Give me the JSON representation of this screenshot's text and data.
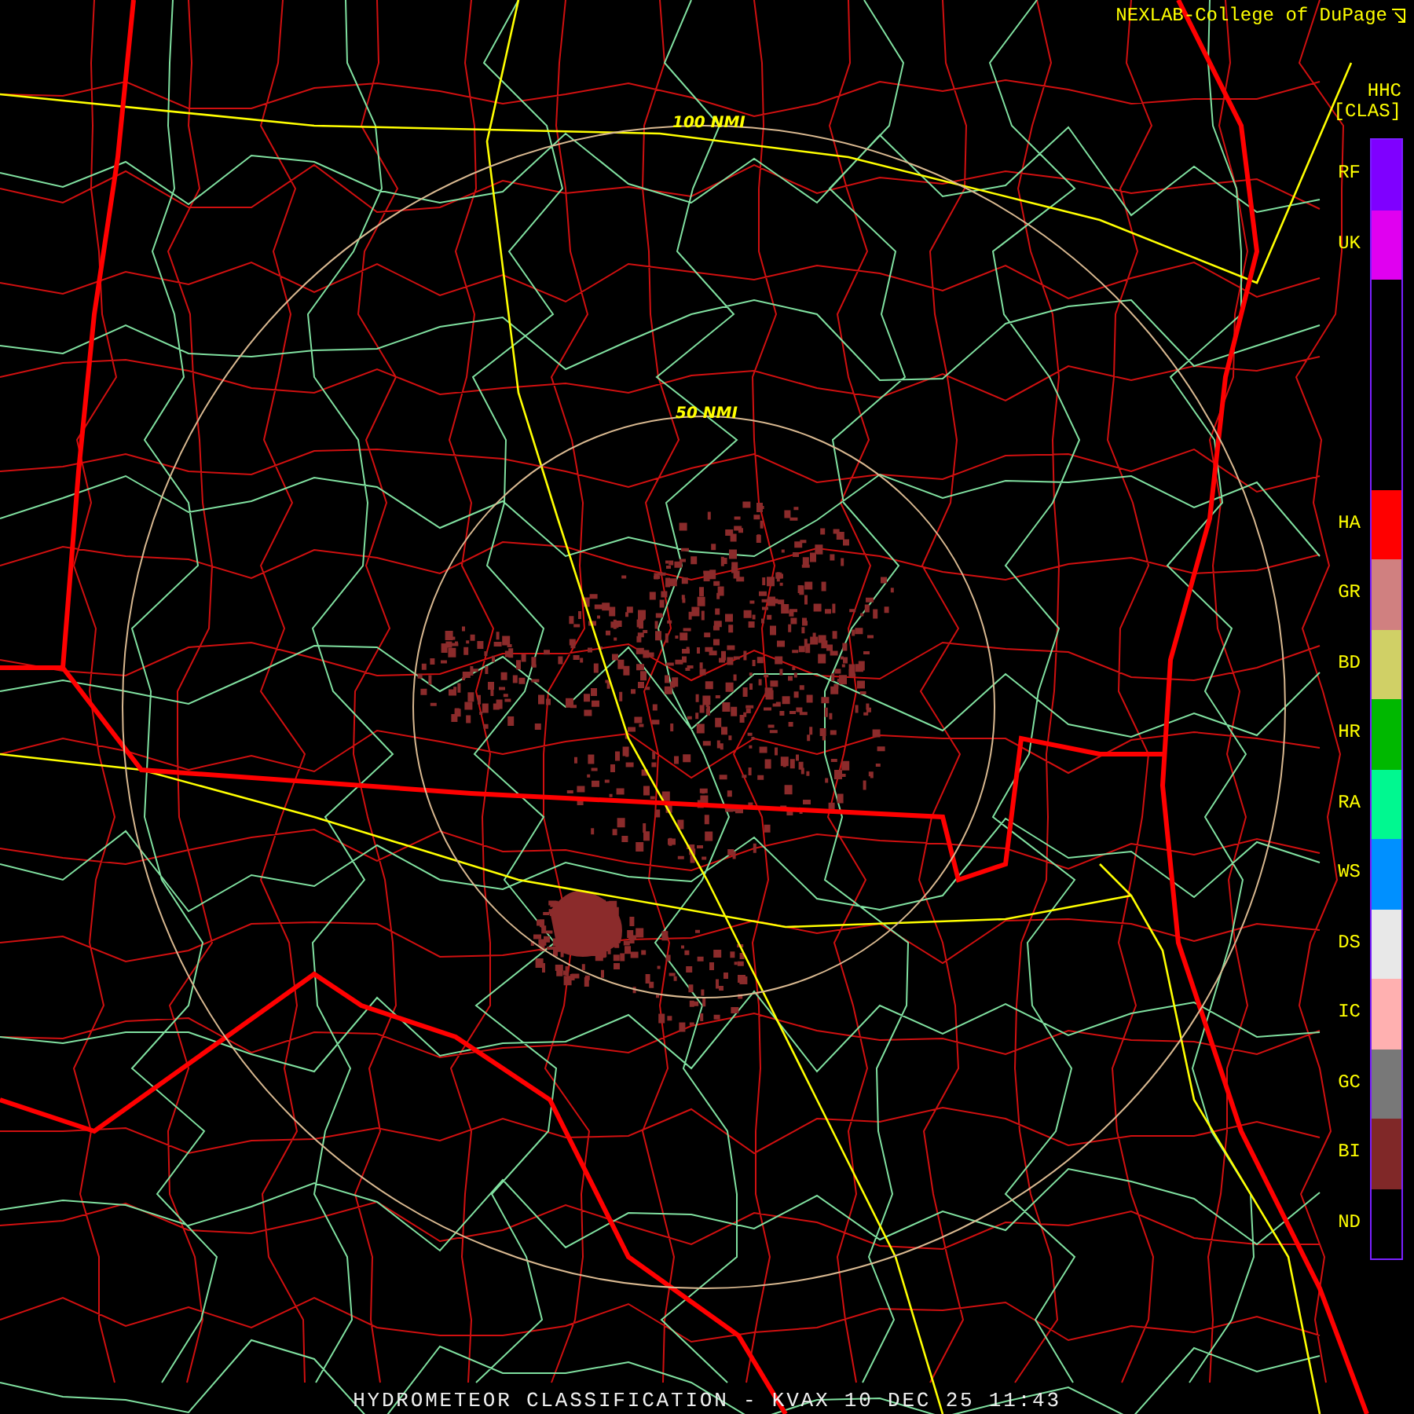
{
  "credit": {
    "text": "NEXLAB-College of DuPage"
  },
  "product": {
    "code": "HHC",
    "type": "[CLAS]"
  },
  "range_rings": [
    {
      "label": "100 NMI"
    },
    {
      "label": "50 NMI"
    }
  ],
  "legend": [
    {
      "kind": "class",
      "label": "RF",
      "color": "#7f00ff"
    },
    {
      "kind": "class",
      "label": "UK",
      "color": "#e000f0"
    },
    {
      "kind": "spacer"
    },
    {
      "kind": "spacer"
    },
    {
      "kind": "spacer"
    },
    {
      "kind": "class",
      "label": "HA",
      "color": "#ff0000"
    },
    {
      "kind": "class",
      "label": "GR",
      "color": "#d08080"
    },
    {
      "kind": "class",
      "label": "BD",
      "color": "#d0d066"
    },
    {
      "kind": "class",
      "label": "HR",
      "color": "#00b800"
    },
    {
      "kind": "class",
      "label": "RA",
      "color": "#00f890"
    },
    {
      "kind": "class",
      "label": "WS",
      "color": "#0090ff"
    },
    {
      "kind": "class",
      "label": "DS",
      "color": "#e8e8e8"
    },
    {
      "kind": "class",
      "label": "IC",
      "color": "#ffb0b0"
    },
    {
      "kind": "class",
      "label": "GC",
      "color": "#787878"
    },
    {
      "kind": "class",
      "label": "BI",
      "color": "#802828"
    },
    {
      "kind": "class",
      "label": "ND",
      "color": "#000000"
    }
  ],
  "caption": {
    "text": "HYDROMETEOR CLASSIFICATION - KVAX 10 DEC 25 11:43"
  }
}
